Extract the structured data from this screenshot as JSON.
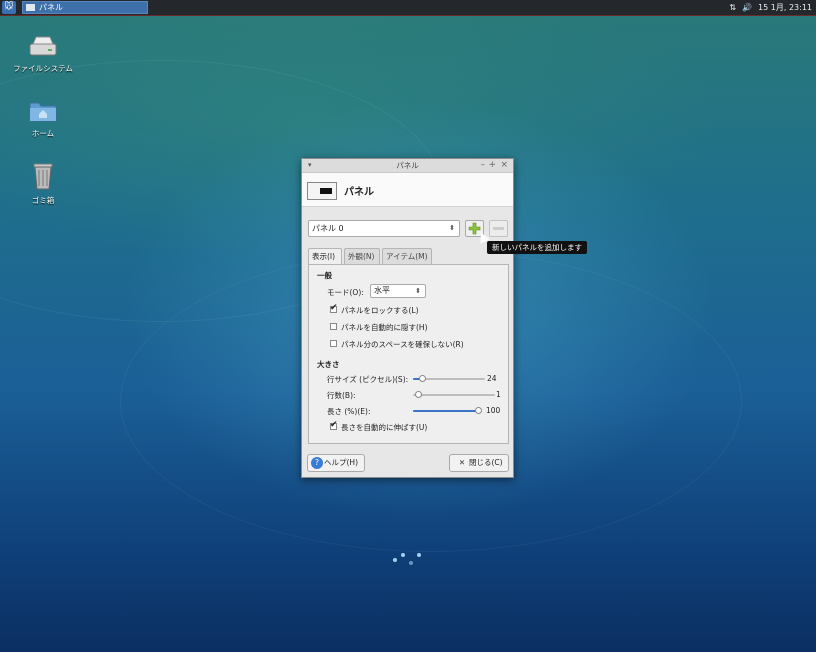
{
  "top_panel": {
    "task_label": "パネル",
    "clock": "15 1月, 23:11"
  },
  "desktop_icons": [
    {
      "label": "ファイルシステム",
      "icon": "drive-icon"
    },
    {
      "label": "ホーム",
      "icon": "home-folder-icon"
    },
    {
      "label": "ゴミ箱",
      "icon": "trash-icon"
    }
  ],
  "dialog": {
    "title": "パネル",
    "header_title": "パネル",
    "panel_select": "パネル 0",
    "tooltip": "新しいパネルを追加します",
    "tabs": [
      "表示(I)",
      "外観(N)",
      "アイテム(M)"
    ],
    "general": {
      "heading": "一般",
      "mode_label": "モード(O):",
      "mode_value": "水平",
      "lock": "パネルをロックする(L)",
      "autohide": "パネルを自動的に隠す(H)",
      "nospace": "パネル分のスペースを確保しない(R)"
    },
    "size": {
      "heading": "大きさ",
      "row_size_label": "行サイズ (ピクセル)(S):",
      "row_size_value": "24",
      "rows_label": "行数(B):",
      "rows_value": "1",
      "length_label": "長さ (%)(E):",
      "length_value": "100",
      "autoexpand": "長さを自動的に伸ばす(U)"
    },
    "help_button": "ヘルプ(H)",
    "close_button": "閉じる(C)"
  }
}
